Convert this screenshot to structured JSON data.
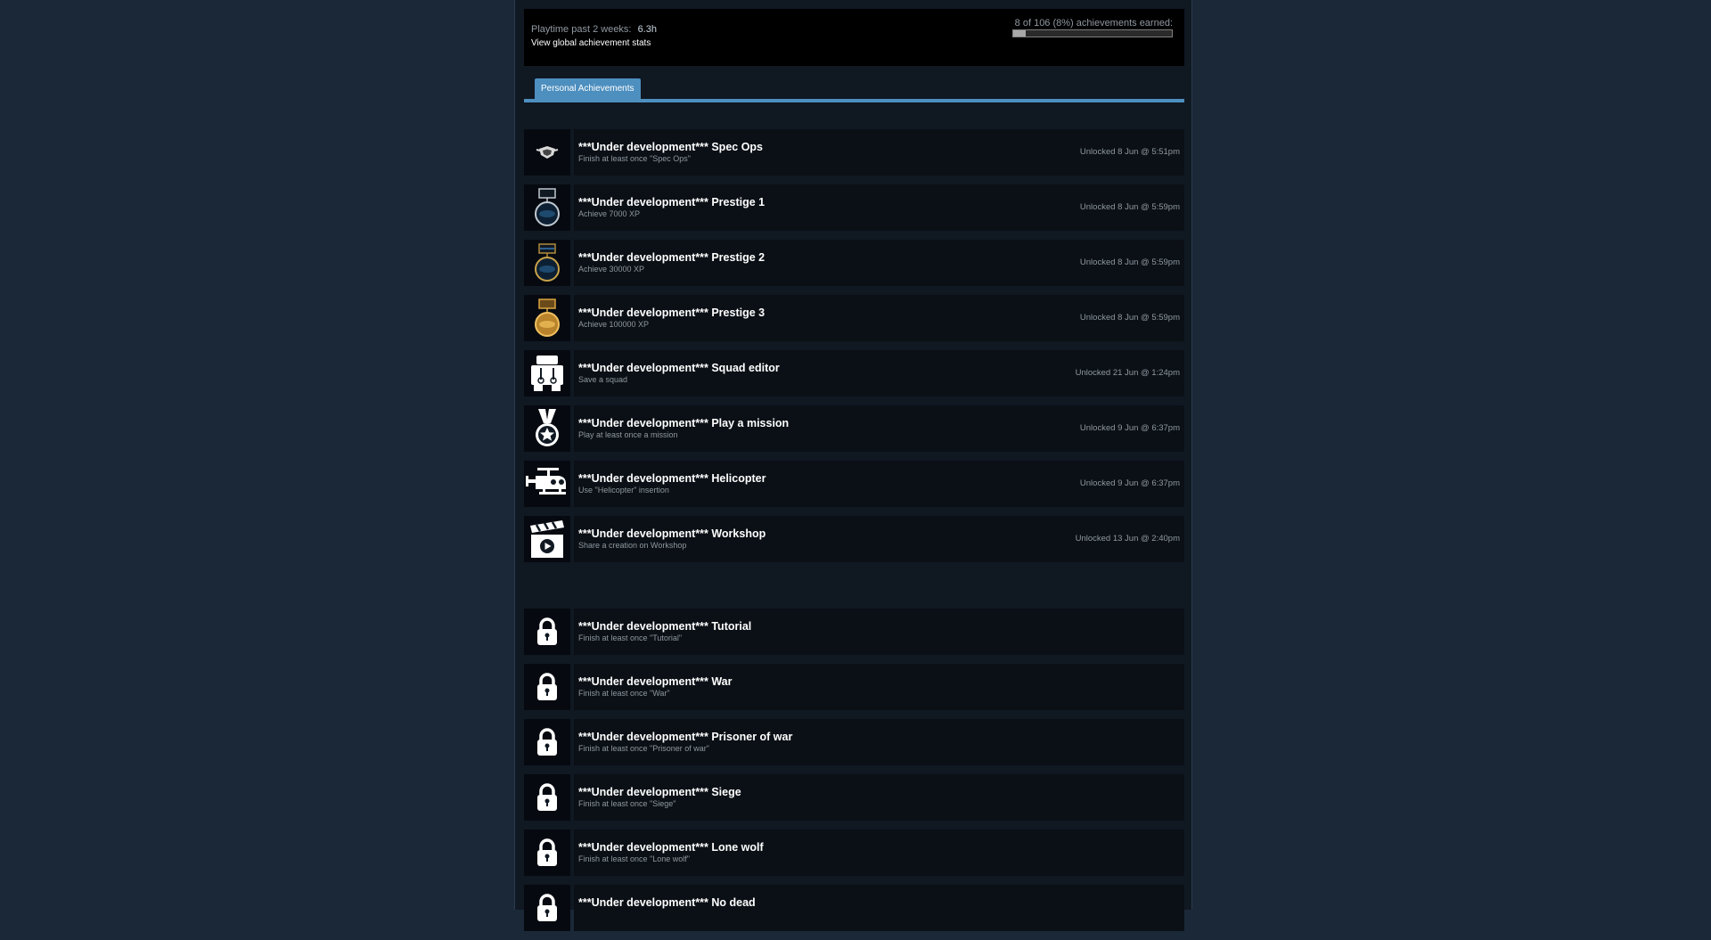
{
  "summary": {
    "playtime_label": "Playtime past 2 weeks:",
    "playtime_value": "6.3h",
    "global_stats_link": "View global achievement stats",
    "earned_label": "8 of 106 (8%) achievements earned:",
    "progress_fraction": 0.08
  },
  "tabs": {
    "active_label": "Personal Achievements"
  },
  "unlocked": [
    {
      "icon": "spec-ops-emblem-icon",
      "title": "***Under development*** Spec Ops",
      "desc": "Finish at least once \"Spec Ops\"",
      "unlock": "Unlocked 8 Jun @ 5:51pm"
    },
    {
      "icon": "prestige-1-medal-icon",
      "title": "***Under development*** Prestige 1",
      "desc": "Achieve 7000 XP",
      "unlock": "Unlocked 8 Jun @ 5:59pm"
    },
    {
      "icon": "prestige-2-medal-icon",
      "title": "***Under development*** Prestige 2",
      "desc": "Achieve 30000 XP",
      "unlock": "Unlocked 8 Jun @ 5:59pm"
    },
    {
      "icon": "prestige-3-medal-icon",
      "title": "***Under development*** Prestige 3",
      "desc": "Achieve 100000 XP",
      "unlock": "Unlocked 8 Jun @ 5:59pm"
    },
    {
      "icon": "squad-editor-icon",
      "title": "***Under development*** Squad editor",
      "desc": "Save a squad",
      "unlock": "Unlocked 21 Jun @ 1:24pm"
    },
    {
      "icon": "star-medal-icon",
      "title": "***Under development*** Play a mission",
      "desc": "Play at least once a mission",
      "unlock": "Unlocked 9 Jun @ 6:37pm"
    },
    {
      "icon": "helicopter-icon",
      "title": "***Under development*** Helicopter",
      "desc": "Use \"Helicopter\" insertion",
      "unlock": "Unlocked 9 Jun @ 6:37pm"
    },
    {
      "icon": "clapperboard-icon",
      "title": "***Under development*** Workshop",
      "desc": "Share a creation on Workshop",
      "unlock": "Unlocked 13 Jun @ 2:40pm"
    }
  ],
  "locked": [
    {
      "icon": "lock-icon",
      "title": "***Under development*** Tutorial",
      "desc": "Finish at least once \"Tutorial\""
    },
    {
      "icon": "lock-icon",
      "title": "***Under development*** War",
      "desc": "Finish at least once \"War\""
    },
    {
      "icon": "lock-icon",
      "title": "***Under development*** Prisoner of war",
      "desc": "Finish at least once \"Prisoner of war\""
    },
    {
      "icon": "lock-icon",
      "title": "***Under development*** Siege",
      "desc": "Finish at least once \"Siege\""
    },
    {
      "icon": "lock-icon",
      "title": "***Under development*** Lone wolf",
      "desc": "Finish at least once \"Lone wolf\""
    },
    {
      "icon": "lock-icon",
      "title": "***Under development*** No dead",
      "desc": ""
    }
  ],
  "colors": {
    "page_bg": "#1b2838",
    "accent": "#4d8fbf",
    "muted_text": "#8f98a0"
  }
}
